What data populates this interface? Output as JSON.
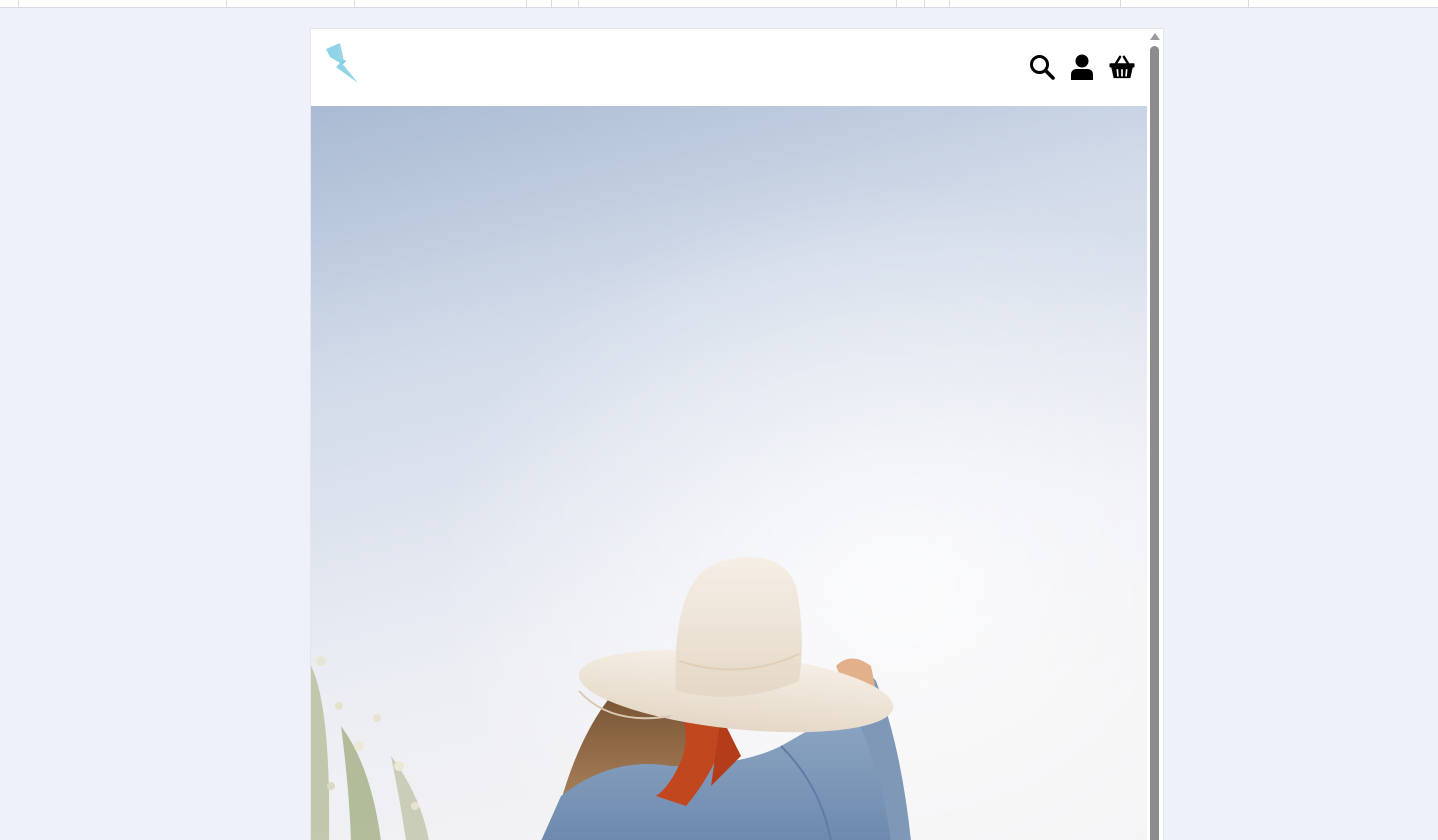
{
  "site": {
    "logo": "lightning-bolt-logo",
    "accent_color": "#8fd3e6"
  },
  "header": {
    "icons": [
      "search-icon",
      "user-icon",
      "basket-icon"
    ]
  },
  "hero": {
    "image": "woman-in-straw-hat-and-denim-jacket"
  }
}
